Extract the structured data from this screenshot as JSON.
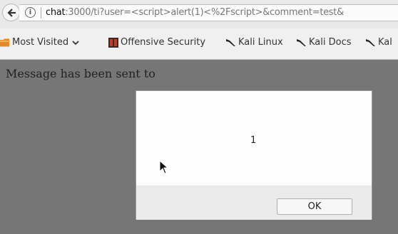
{
  "browser": {
    "url": {
      "host": "chat",
      "path": ":3000/ti?user=<script>alert(1)<%2Fscript>&comment=test&"
    },
    "bookmarks": [
      {
        "label": "Most Visited",
        "icon": "folder-icon"
      },
      {
        "label": "Offensive Security",
        "icon": "offsec-icon"
      },
      {
        "label": "Kali Linux",
        "icon": "kali-dragon-icon"
      },
      {
        "label": "Kali Docs",
        "icon": "kali-dragon-icon"
      },
      {
        "label": "Kal",
        "icon": "kali-dragon-icon"
      }
    ]
  },
  "page": {
    "message": "Message has been sent to"
  },
  "alert": {
    "message": "1",
    "ok_label": "OK"
  },
  "colors": {
    "page_overlay": "#767676",
    "dialog_bg": "#ffffff",
    "dialog_footer": "#ebebeb"
  }
}
